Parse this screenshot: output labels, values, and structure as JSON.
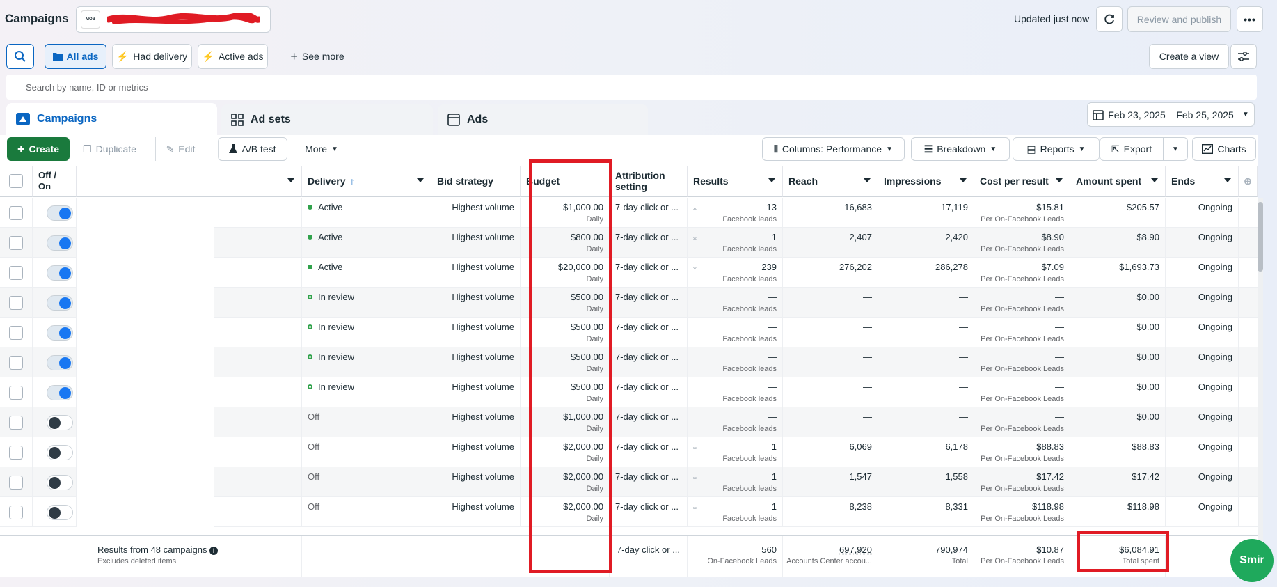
{
  "header": {
    "title": "Campaigns",
    "account_logo": "MOB",
    "updated": "Updated just now",
    "review_publish": "Review and publish",
    "more": "•••"
  },
  "filters": {
    "all_ads": "All ads",
    "had_delivery": "Had delivery",
    "active_ads": "Active ads",
    "see_more": "See more",
    "create_view": "Create a view"
  },
  "search": {
    "placeholder": "Search by name, ID or metrics"
  },
  "tabs": [
    {
      "label": "Campaigns"
    },
    {
      "label": "Ad sets"
    },
    {
      "label": "Ads"
    }
  ],
  "date_range": "Feb 23, 2025 – Feb 25, 2025",
  "toolbar": {
    "create": "Create",
    "duplicate": "Duplicate",
    "edit": "Edit",
    "ab_test": "A/B test",
    "more": "More",
    "columns": "Columns: Performance",
    "breakdown": "Breakdown",
    "reports": "Reports",
    "export": "Export",
    "charts": "Charts"
  },
  "columns": {
    "offon": "Off / On",
    "delivery": "Delivery",
    "bid": "Bid strategy",
    "budget": "Budget",
    "attribution": "Attribution setting",
    "results": "Results",
    "reach": "Reach",
    "impressions": "Impressions",
    "cpr": "Cost per result",
    "spent": "Amount spent",
    "ends": "Ends"
  },
  "rows": [
    {
      "on": true,
      "status": "Active",
      "kind": "active",
      "bid": "Highest volume",
      "budget": "$1,000.00",
      "budget_sub": "Daily",
      "attr": "7-day click or ...",
      "results": "13",
      "results_sub": "Facebook leads",
      "reach": "16,683",
      "impr": "17,119",
      "cpr": "$15.81",
      "cpr_sub": "Per On-Facebook Leads",
      "spent": "$205.57",
      "ends": "Ongoing"
    },
    {
      "on": true,
      "status": "Active",
      "kind": "active",
      "bid": "Highest volume",
      "budget": "$800.00",
      "budget_sub": "Daily",
      "attr": "7-day click or ...",
      "results": "1",
      "results_sub": "Facebook leads",
      "reach": "2,407",
      "impr": "2,420",
      "cpr": "$8.90",
      "cpr_sub": "Per On-Facebook Leads",
      "spent": "$8.90",
      "ends": "Ongoing"
    },
    {
      "on": true,
      "status": "Active",
      "kind": "active",
      "bid": "Highest volume",
      "budget": "$20,000.00",
      "budget_sub": "Daily",
      "attr": "7-day click or ...",
      "results": "239",
      "results_sub": "Facebook leads",
      "reach": "276,202",
      "impr": "286,278",
      "cpr": "$7.09",
      "cpr_sub": "Per On-Facebook Leads",
      "spent": "$1,693.73",
      "ends": "Ongoing"
    },
    {
      "on": true,
      "status": "In review",
      "kind": "review",
      "bid": "Highest volume",
      "budget": "$500.00",
      "budget_sub": "Daily",
      "attr": "7-day click or ...",
      "results": "—",
      "results_sub": "Facebook leads",
      "reach": "—",
      "impr": "—",
      "cpr": "—",
      "cpr_sub": "Per On-Facebook Leads",
      "spent": "$0.00",
      "ends": "Ongoing"
    },
    {
      "on": true,
      "status": "In review",
      "kind": "review",
      "bid": "Highest volume",
      "budget": "$500.00",
      "budget_sub": "Daily",
      "attr": "7-day click or ...",
      "results": "—",
      "results_sub": "Facebook leads",
      "reach": "—",
      "impr": "—",
      "cpr": "—",
      "cpr_sub": "Per On-Facebook Leads",
      "spent": "$0.00",
      "ends": "Ongoing"
    },
    {
      "on": true,
      "status": "In review",
      "kind": "review",
      "bid": "Highest volume",
      "budget": "$500.00",
      "budget_sub": "Daily",
      "attr": "7-day click or ...",
      "results": "—",
      "results_sub": "Facebook leads",
      "reach": "—",
      "impr": "—",
      "cpr": "—",
      "cpr_sub": "Per On-Facebook Leads",
      "spent": "$0.00",
      "ends": "Ongoing"
    },
    {
      "on": true,
      "status": "In review",
      "kind": "review",
      "bid": "Highest volume",
      "budget": "$500.00",
      "budget_sub": "Daily",
      "attr": "7-day click or ...",
      "results": "—",
      "results_sub": "Facebook leads",
      "reach": "—",
      "impr": "—",
      "cpr": "—",
      "cpr_sub": "Per On-Facebook Leads",
      "spent": "$0.00",
      "ends": "Ongoing"
    },
    {
      "on": false,
      "status": "Off",
      "kind": "off",
      "bid": "Highest volume",
      "budget": "$1,000.00",
      "budget_sub": "Daily",
      "attr": "7-day click or ...",
      "results": "—",
      "results_sub": "Facebook leads",
      "reach": "—",
      "impr": "—",
      "cpr": "—",
      "cpr_sub": "Per On-Facebook Leads",
      "spent": "$0.00",
      "ends": "Ongoing"
    },
    {
      "on": false,
      "status": "Off",
      "kind": "off",
      "bid": "Highest volume",
      "budget": "$2,000.00",
      "budget_sub": "Daily",
      "attr": "7-day click or ...",
      "results": "1",
      "results_sub": "Facebook leads",
      "reach": "6,069",
      "impr": "6,178",
      "cpr": "$88.83",
      "cpr_sub": "Per On-Facebook Leads",
      "spent": "$88.83",
      "ends": "Ongoing"
    },
    {
      "on": false,
      "status": "Off",
      "kind": "off",
      "bid": "Highest volume",
      "budget": "$2,000.00",
      "budget_sub": "Daily",
      "attr": "7-day click or ...",
      "results": "1",
      "results_sub": "Facebook leads",
      "reach": "1,547",
      "impr": "1,558",
      "cpr": "$17.42",
      "cpr_sub": "Per On-Facebook Leads",
      "spent": "$17.42",
      "ends": "Ongoing"
    },
    {
      "on": false,
      "status": "Off",
      "kind": "off",
      "bid": "Highest volume",
      "budget": "$2,000.00",
      "budget_sub": "Daily",
      "attr": "7-day click or ...",
      "results": "1",
      "results_sub": "Facebook leads",
      "reach": "8,238",
      "impr": "8,331",
      "cpr": "$118.98",
      "cpr_sub": "Per On-Facebook Leads",
      "spent": "$118.98",
      "ends": "Ongoing"
    }
  ],
  "footer": {
    "label": "Results from 48 campaigns",
    "sub": "Excludes deleted items",
    "attr": "7-day click or ...",
    "results": "560",
    "results_sub": "On-Facebook Leads",
    "reach": "697,920",
    "reach_sub": "Accounts Center accou...",
    "impr": "790,974",
    "impr_sub": "Total",
    "cpr": "$10.87",
    "cpr_sub": "Per On-Facebook Leads",
    "spent": "$6,084.91",
    "spent_sub": "Total spent"
  },
  "badge": "Smir",
  "colors": {
    "accent": "#0a66c2",
    "create_green": "#1a7a3d",
    "highlight_red": "#e01b24",
    "toggle_on": "#1877f2"
  }
}
